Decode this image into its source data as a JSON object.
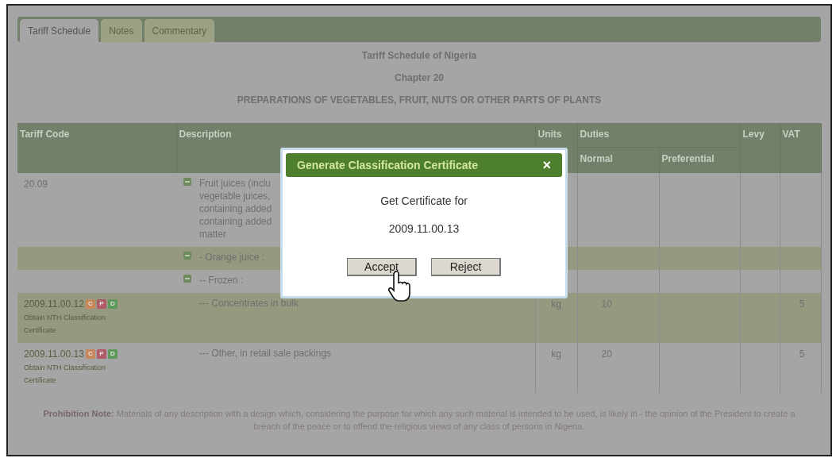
{
  "tabs": [
    {
      "label": "Tariff Schedule",
      "selected": true
    },
    {
      "label": "Notes",
      "selected": false
    },
    {
      "label": "Commentary",
      "selected": false
    }
  ],
  "heading": {
    "title": "Tariff Schedule of Nigeria",
    "chapter": "Chapter 20",
    "subtitle": "PREPARATIONS OF VEGETABLES, FRUIT, NUTS OR OTHER PARTS OF PLANTS"
  },
  "table": {
    "columns": {
      "tariff_code": "Tariff Code",
      "description": "Description",
      "units": "Units",
      "duties": "Duties",
      "normal": "Normal",
      "preferential": "Preferential",
      "levy": "Levy",
      "vat": "VAT"
    },
    "rows": [
      {
        "highlighted": false,
        "code": "20.09",
        "expanded": true,
        "description": [
          "Fruit juices (inclu",
          "vegetable juices,",
          "containing added",
          "containing added",
          "matter"
        ]
      },
      {
        "highlighted": true,
        "expanded": true,
        "description": [
          "- Orange juice :"
        ]
      },
      {
        "highlighted": false,
        "expanded": true,
        "description": [
          "-- Frozen :"
        ]
      },
      {
        "highlighted": true,
        "code": "2009.11.00.12",
        "badges": [
          {
            "label": "C",
            "color": "#c8875a"
          },
          {
            "label": "P",
            "color": "#b05a68"
          },
          {
            "label": "D",
            "color": "#5d9a5a"
          }
        ],
        "link": "Obtain NTH Classification Certificate",
        "description": [
          "--- Concentrates in bulk"
        ],
        "units": "kg",
        "normal": "10",
        "vat": "5"
      },
      {
        "highlighted": false,
        "code": "2009.11.00.13",
        "badges": [
          {
            "label": "C",
            "color": "#c8875a"
          },
          {
            "label": "P",
            "color": "#b05a68"
          },
          {
            "label": "D",
            "color": "#5d9a5a"
          }
        ],
        "link": "Obtain NTH Classification Certificate",
        "description": [
          "--- Other, in retail sale packings"
        ],
        "units": "kg",
        "normal": "20",
        "vat": "5"
      }
    ]
  },
  "note": {
    "label": "Prohibition Note:",
    "text": "Materials of any description with a design which, considering the purpose for which any such material is intended to be used, is likely in - the opinion of the President to create a breach of the peace or to offend the religious views of any class of persons in Nigeria."
  },
  "dialog": {
    "title": "Generate Classification Certificate",
    "close": "×",
    "message": "Get Certificate for",
    "code": "2009.11.00.13",
    "buttons": [
      "Accept",
      "Reject"
    ]
  }
}
